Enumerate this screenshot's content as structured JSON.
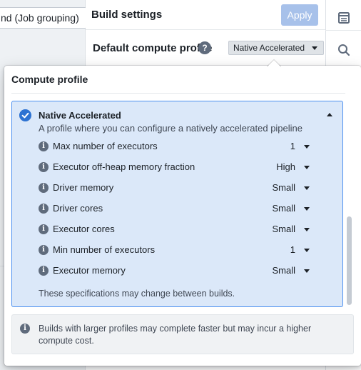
{
  "left": {
    "job_grouping_label": "nd (Job grouping)"
  },
  "header": {
    "title": "Build settings",
    "apply_label": "Apply"
  },
  "profile_row": {
    "label": "Default compute profile",
    "help_glyph": "?",
    "selected": "Native Accelerated"
  },
  "popover": {
    "title": "Compute profile",
    "card": {
      "title": "Native Accelerated",
      "description": "A profile where you can configure a natively accelerated pipeline",
      "specs": [
        {
          "label": "Max number of executors",
          "value": "1"
        },
        {
          "label": "Executor off-heap memory fraction",
          "value": "High"
        },
        {
          "label": "Driver memory",
          "value": "Small"
        },
        {
          "label": "Driver cores",
          "value": "Small"
        },
        {
          "label": "Executor cores",
          "value": "Small"
        },
        {
          "label": "Min number of executors",
          "value": "1"
        },
        {
          "label": "Executor memory",
          "value": "Small"
        }
      ],
      "note": "These specifications may change between builds."
    },
    "footer_note": "Builds with larger profiles may complete faster but may incur a higher compute cost."
  },
  "icons": {
    "info_glyph": "i",
    "right_bar": [
      "panel-icon",
      "search-icon"
    ]
  },
  "colors": {
    "accent": "#2d72d2",
    "selected_bg": "#dbe8f9",
    "apply_disabled": "#a7c1ea"
  }
}
